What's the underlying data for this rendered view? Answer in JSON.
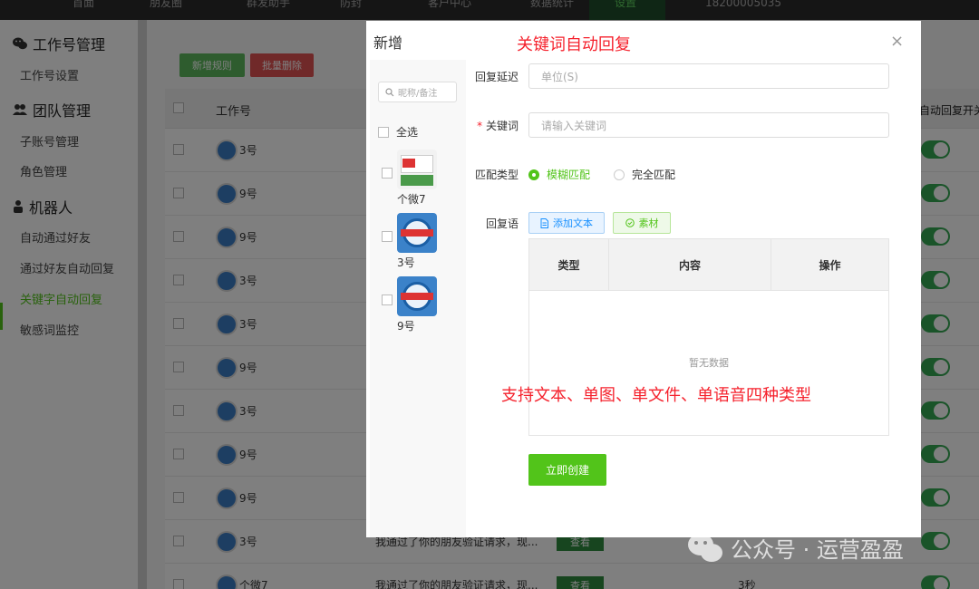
{
  "topbar": {
    "tabs": [
      {
        "label": "首面"
      },
      {
        "label": "朋友圈"
      },
      {
        "label": "群发助手"
      },
      {
        "label": "防封"
      },
      {
        "label": "客户中心"
      },
      {
        "label": "数据统计"
      },
      {
        "label": "设置",
        "active": true
      },
      {
        "label": "18200005035"
      }
    ]
  },
  "sidebar": {
    "groups": [
      {
        "title": "工作号管理",
        "icon": "wechat-icon",
        "items": [
          "工作号设置"
        ]
      },
      {
        "title": "团队管理",
        "icon": "team-icon",
        "items": [
          "子账号管理",
          "角色管理"
        ]
      },
      {
        "title": "机器人",
        "icon": "robot-icon",
        "items": [
          "自动通过好友",
          "通过好友自动回复",
          "关键字自动回复",
          "敏感词监控"
        ]
      }
    ],
    "active_item": "关键字自动回复"
  },
  "main": {
    "add_rule_label": "新增规则",
    "batch_delete_label": "批量删除",
    "columns": {
      "name": "工作号",
      "switch": "自动回复开关"
    },
    "rows": [
      {
        "name": "3号",
        "msg": "",
        "view": "",
        "delay": ""
      },
      {
        "name": "9号",
        "msg": "",
        "view": "",
        "delay": ""
      },
      {
        "name": "9号",
        "msg": "",
        "view": "",
        "delay": ""
      },
      {
        "name": "3号",
        "msg": "",
        "view": "",
        "delay": ""
      },
      {
        "name": "3号",
        "msg": "",
        "view": "",
        "delay": ""
      },
      {
        "name": "9号",
        "msg": "",
        "view": "",
        "delay": ""
      },
      {
        "name": "3号",
        "msg": "",
        "view": "",
        "delay": ""
      },
      {
        "name": "9号",
        "msg": "",
        "view": "",
        "delay": ""
      },
      {
        "name": "9号",
        "msg": "",
        "view": "",
        "delay": ""
      },
      {
        "name": "3号",
        "msg": "我通过了你的朋友验证请求，现...",
        "view": "查看",
        "delay": ""
      },
      {
        "name": "个微7",
        "msg": "我通过了你的朋友验证请求，现...",
        "view": "查看",
        "delay": "3秒"
      }
    ]
  },
  "modal": {
    "title": "新增",
    "annotation_title": "关键词自动回复",
    "annotation_bottom": "支持文本、单图、单文件、单语音四种类型",
    "close": "×",
    "search_placeholder": "昵称/备注",
    "select_all": "全选",
    "contacts": [
      {
        "name": "个微7"
      },
      {
        "name": "3号"
      },
      {
        "name": "9号"
      }
    ],
    "delay_label": "回复延迟",
    "delay_placeholder": "单位(S)",
    "keyword_required": "*",
    "keyword_label": "关键词",
    "keyword_placeholder": "请输入关键词",
    "match_label": "匹配类型",
    "match_fuzzy": "模糊匹配",
    "match_exact": "完全匹配",
    "reply_label": "回复语",
    "add_text_label": "添加文本",
    "material_label": "素材",
    "table_cols": {
      "type": "类型",
      "content": "内容",
      "action": "操作"
    },
    "empty_text": "暂无数据",
    "submit_label": "立即创建"
  },
  "watermark": {
    "text": "公众号 · 运营盈盈"
  },
  "colors": {
    "accent": "#52c41a",
    "danger": "#f5222d",
    "link": "#1890ff"
  }
}
